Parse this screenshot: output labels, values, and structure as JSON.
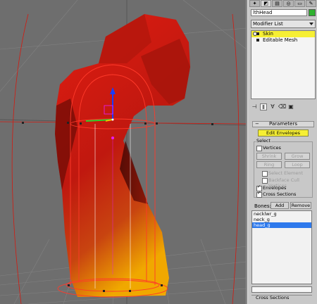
{
  "command_panel": {
    "tabs": [
      "create-icon",
      "modify-icon",
      "hierarchy-icon",
      "motion-icon",
      "display-icon",
      "utilities-icon"
    ],
    "object_name": "lthHead",
    "object_color": "#2fb12f",
    "modifier_list_label": "Modifier List",
    "modifier_stack": [
      {
        "label": "Skin",
        "selected": true
      },
      {
        "label": "Editable Mesh",
        "selected": false
      }
    ]
  },
  "parameters": {
    "title": "Parameters",
    "edit_envelopes_label": "Edit Envelopes",
    "select_group_label": "Select",
    "vertices_label": "Vertices",
    "shrink_label": "Shrink",
    "grow_label": "Grow",
    "ring_label": "Ring",
    "loop_label": "Loop",
    "select_element_label": "Select Element",
    "backface_cull_label": "Backface Cull Vertices",
    "envelopes_label": "Envelopes",
    "cross_sections_label": "Cross Sections",
    "bones_label": "Bones:",
    "add_label": "Add",
    "remove_label": "Remove",
    "bones": [
      {
        "name": "necklwr_g",
        "selected": false
      },
      {
        "name": "neck_g",
        "selected": false
      },
      {
        "name": "head_g",
        "selected": true
      }
    ],
    "cross_sections_rollout": "Cross Sections"
  },
  "colors": {
    "selection_yellow": "#f6ef34",
    "list_selection_blue": "#2d79ec",
    "mesh_red": "#c81a10"
  }
}
